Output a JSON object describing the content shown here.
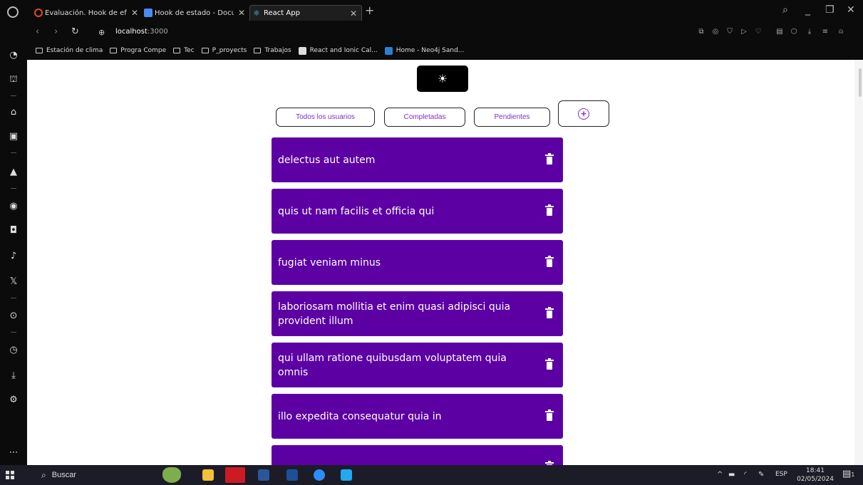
{
  "browser": {
    "tabs": [
      {
        "title": "Evaluación. Hook de efecto",
        "favicon_color": "#e24a1a"
      },
      {
        "title": "Hook de estado - Docume",
        "favicon_color": "#4a8af4"
      },
      {
        "title": "React App",
        "favicon_color": "#61dafb"
      }
    ],
    "new_tab_label": "+",
    "address": {
      "host": "localhost",
      "port": ":3000"
    },
    "bookmarks": [
      {
        "label": "Estación de clima",
        "icon": "folder-icon"
      },
      {
        "label": "Progra Compe",
        "icon": "folder-icon"
      },
      {
        "label": "Tec",
        "icon": "folder-icon"
      },
      {
        "label": "P_proyects",
        "icon": "folder-icon"
      },
      {
        "label": "Trabajos",
        "icon": "folder-icon"
      },
      {
        "label": "React and Ionic Cal...",
        "icon": "site-icon"
      },
      {
        "label": "Home - Neo4j Sand...",
        "icon": "neo4j-icon"
      }
    ]
  },
  "app": {
    "theme_toggle_icon": "☀",
    "filters": {
      "all": "Todos los usuarios",
      "completed": "Completadas",
      "pending": "Pendientes"
    },
    "add_icon": "+",
    "accent_color": "#7b2fc7",
    "card_color": "#5c00a3",
    "todos": [
      {
        "title": "delectus aut autem"
      },
      {
        "title": "quis ut nam facilis et officia qui"
      },
      {
        "title": "fugiat veniam minus"
      },
      {
        "title": "laboriosam mollitia et enim quasi adipisci quia provident illum"
      },
      {
        "title": "qui ullam ratione quibusdam voluptatem quia omnis"
      },
      {
        "title": "illo expedita consequatur quia in"
      },
      {
        "title": ""
      }
    ]
  },
  "taskbar": {
    "search_placeholder": "Buscar",
    "language": "ESP",
    "time": "18:41",
    "date": "02/05/2024",
    "notification_count": "1"
  }
}
